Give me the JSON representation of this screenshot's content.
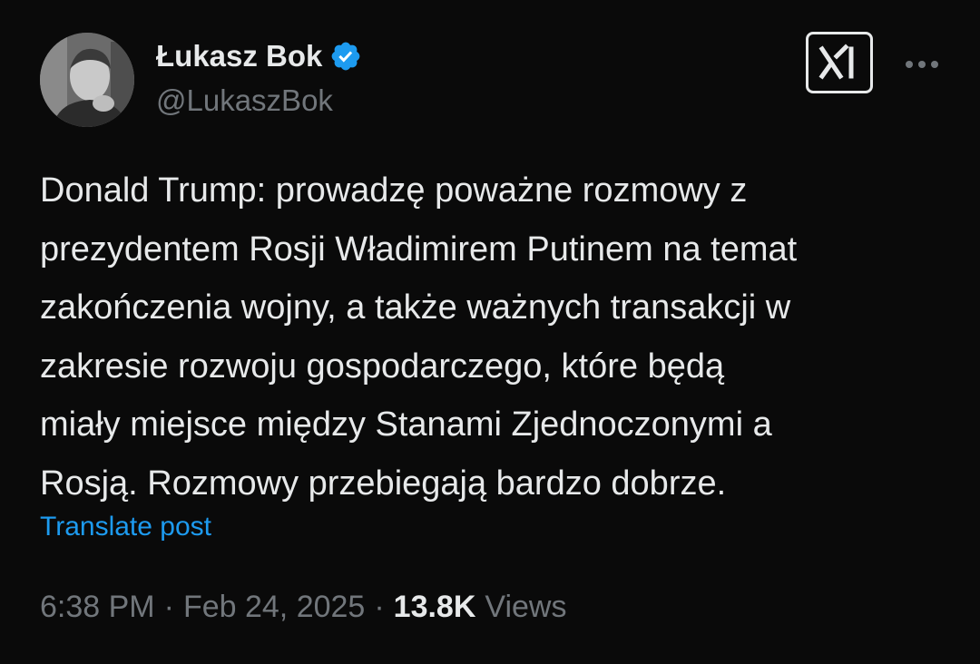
{
  "author": {
    "display_name": "Łukasz Bok",
    "handle": "@LukaszBok",
    "verified": true,
    "verified_color": "#1d9bf0"
  },
  "header_actions": {
    "grok_icon": "xai-grok-icon",
    "more_icon": "more-horizontal-icon"
  },
  "post": {
    "text": "Donald Trump: prowadzę poważne rozmowy z\nprezydentem Rosji Władimirem Putinem na temat\nzakończenia wojny, a także ważnych transakcji w\nzakresie rozwoju gospodarczego, które będą\nmiały miejsce między Stanami Zjednoczonymi a\nRosją. Rozmowy przebiegają bardzo dobrze.",
    "translate_label": "Translate post"
  },
  "meta": {
    "time": "6:38 PM",
    "separator": "·",
    "date": "Feb 24, 2025",
    "views_count": "13.8K",
    "views_label": "Views"
  },
  "colors": {
    "background": "#000000",
    "text": "#e7e9ea",
    "secondary": "#71767b",
    "link": "#1d9bf0"
  }
}
